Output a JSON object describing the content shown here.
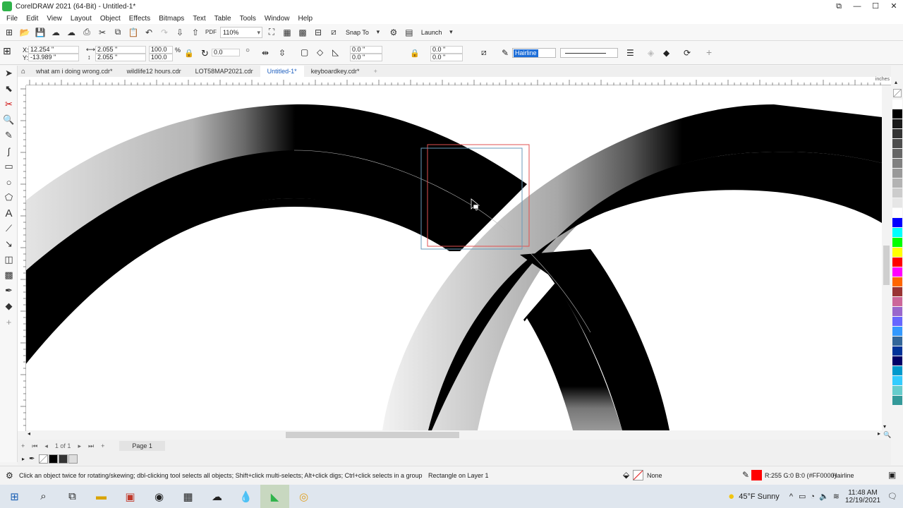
{
  "app": {
    "title": "CorelDRAW 2021 (64-Bit) - Untitled-1*"
  },
  "menu": [
    "File",
    "Edit",
    "View",
    "Layout",
    "Object",
    "Effects",
    "Bitmaps",
    "Text",
    "Table",
    "Tools",
    "Window",
    "Help"
  ],
  "std_toolbar": {
    "zoom": "110%",
    "snap_to": "Snap To",
    "launch": "Launch"
  },
  "property_bar": {
    "x_label": "X:",
    "x_value": "12.254 \"",
    "y_label": "Y:",
    "y_value": "-13.989 \"",
    "width": "2.055 \"",
    "height": "2.055 \"",
    "scale_w": "100.0",
    "scale_h": "100.0",
    "pct": "%",
    "rotation": "0.0",
    "corner_1": "0.0 \"",
    "corner_2": "0.0 \"",
    "corner_3": "0.0 \"",
    "corner_4": "0.0 \"",
    "outline_width": "Hairline"
  },
  "tabs": [
    {
      "label": "what am i doing wrong.cdr*",
      "active": false
    },
    {
      "label": "wildlife12 hours.cdr",
      "active": false
    },
    {
      "label": "LOT58MAP2021.cdr",
      "active": false
    },
    {
      "label": "Untitled-1*",
      "active": true
    },
    {
      "label": "keyboardkey.cdr*",
      "active": false
    }
  ],
  "ruler": {
    "unit": "inches"
  },
  "page_nav": {
    "of_label": "1 of 1",
    "page_tab": "Page 1"
  },
  "status": {
    "hint": "Click an object twice for rotating/skewing; dbl-clicking tool selects all objects; Shift+click multi-selects; Alt+click digs; Ctrl+click selects in a group",
    "selection": "Rectangle on Layer 1",
    "fill": "None",
    "outline_color_text": "R:255 G:0 B:0 (#FF0000)",
    "outline_width": "Hairline",
    "outline_color": "#FF0000"
  },
  "taskbar": {
    "weather": "45°F  Sunny",
    "time": "11:48 AM",
    "date": "12/19/2021"
  },
  "palette_colors": [
    "#ffffff",
    "#000000",
    "#1a1a1a",
    "#333333",
    "#4d4d4d",
    "#666666",
    "#808080",
    "#999999",
    "#b3b3b3",
    "#cccccc",
    "#e6e6e6",
    "#ffffff",
    "#0000ff",
    "#00ffff",
    "#00ff00",
    "#ffff00",
    "#ff0000",
    "#ff00ff",
    "#ff6600",
    "#993333",
    "#cc6699",
    "#9966cc",
    "#6666ff",
    "#3399ff",
    "#336699",
    "#003399",
    "#000066",
    "#0099cc",
    "#33ccff",
    "#66cccc",
    "#339999"
  ]
}
